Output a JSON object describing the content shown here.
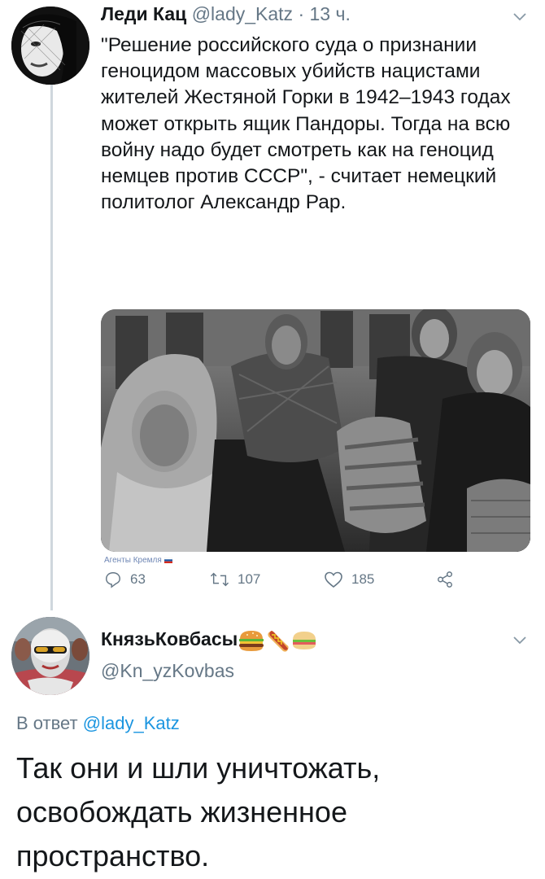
{
  "tweet": {
    "author_name": "Леди Кац",
    "author_handle": "@lady_Katz",
    "separator": "·",
    "time": "13 ч.",
    "text": "\"Решение российского суда о признании геноцидом массовых убийств нацистами жителей Жестяной Горки в 1942–1943 годах может открыть ящик Пандоры. Тогда на всю войну надо будет смотреть как на геноцид немцев против СССР\", - считает немецкий политолог Александр Рар.",
    "media_watermark": "Агенты Кремля",
    "actions": {
      "replies": "63",
      "retweets": "107",
      "likes": "185"
    }
  },
  "reply": {
    "author_name": "КнязьКовбасы",
    "author_handle": "@Kn_yzKovbas",
    "reply_prefix": "В ответ",
    "reply_to_handle": "@lady_Katz",
    "text": "Так они и шли уничтожать, освобождать жизненное пространство."
  },
  "icons": {
    "name_emoji": [
      "burger-icon",
      "hotdog-icon",
      "sandwich-icon"
    ],
    "actions": [
      "reply-icon",
      "retweet-icon",
      "like-icon",
      "share-icon"
    ]
  },
  "colors": {
    "text": "#14171a",
    "secondary": "#657786",
    "link": "#1b95e0",
    "thread_line": "#cfd7dd"
  }
}
